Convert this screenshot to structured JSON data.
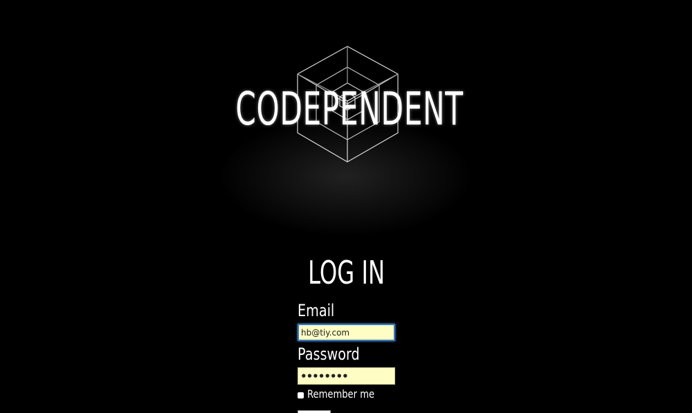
{
  "brand": {
    "title": "CODEPENDENT",
    "logo_icon": "nested-cube-icon"
  },
  "login": {
    "heading": "LOG IN",
    "email": {
      "label": "Email",
      "value": "hb@tiy.com"
    },
    "password": {
      "label": "Password",
      "value": "••••••••"
    },
    "remember": {
      "label": "Remember me",
      "checked": false
    }
  },
  "colors": {
    "background": "#000000",
    "text": "#ffffff",
    "input_fill": "#fdfdc4",
    "focus_ring": "#3a78c2"
  }
}
